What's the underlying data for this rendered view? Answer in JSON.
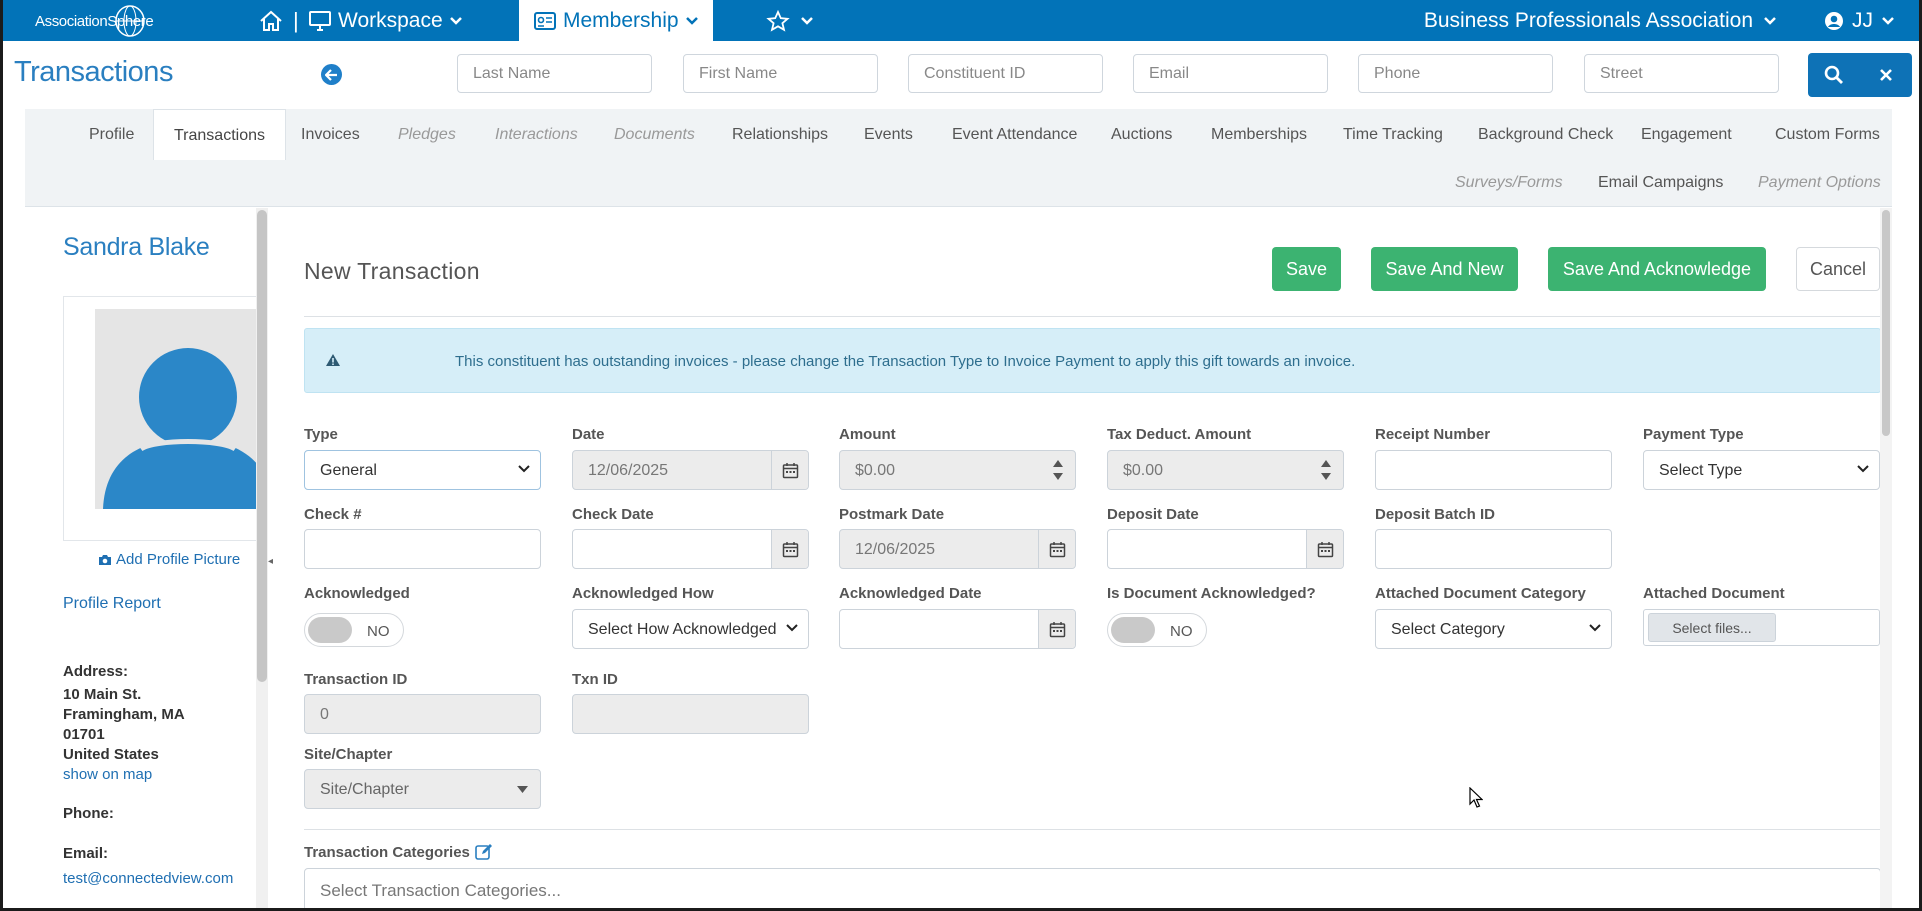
{
  "topbar": {
    "logo_text": "AssociationSphere",
    "separator": "|",
    "workspace_label": "Workspace",
    "membership_label": "Membership",
    "org_name": "Business Professionals Association",
    "user_initials": "JJ"
  },
  "search": {
    "page_title": "Transactions",
    "fields": {
      "last_name": "Last Name",
      "first_name": "First Name",
      "constituent_id": "Constituent ID",
      "email": "Email",
      "phone": "Phone",
      "street": "Street"
    }
  },
  "tabs": {
    "profile": "Profile",
    "transactions": "Transactions",
    "invoices": "Invoices",
    "pledges": "Pledges",
    "interactions": "Interactions",
    "documents": "Documents",
    "relationships": "Relationships",
    "events": "Events",
    "event_attendance": "Event Attendance",
    "auctions": "Auctions",
    "memberships": "Memberships",
    "time_tracking": "Time Tracking",
    "background_check": "Background Check",
    "engagement": "Engagement",
    "custom_forms": "Custom Forms",
    "surveys_forms": "Surveys/Forms",
    "email_campaigns": "Email Campaigns",
    "payment_options": "Payment Options"
  },
  "profile": {
    "name": "Sandra Blake",
    "add_picture": "Add Profile Picture",
    "profile_report": "Profile Report",
    "address_label": "Address:",
    "address_line1": "10 Main St.",
    "address_line2": "Framingham, MA",
    "address_line3": "01701",
    "address_line4": "United States",
    "show_on_map": "show on map",
    "phone_label": "Phone:",
    "email_label": "Email:",
    "email": "test@connectedview.com"
  },
  "form": {
    "title": "New Transaction",
    "buttons": {
      "save": "Save",
      "save_and_new": "Save And New",
      "save_and_acknowledge": "Save And Acknowledge",
      "cancel": "Cancel"
    },
    "alert": "This constituent has outstanding invoices - please change the Transaction Type to Invoice Payment to apply this gift towards an invoice.",
    "labels": {
      "type": "Type",
      "date": "Date",
      "amount": "Amount",
      "tax_deduct_amount": "Tax Deduct. Amount",
      "receipt_number": "Receipt Number",
      "payment_type": "Payment Type",
      "check_no": "Check #",
      "check_date": "Check Date",
      "postmark_date": "Postmark Date",
      "deposit_date": "Deposit Date",
      "deposit_batch_id": "Deposit Batch ID",
      "acknowledged": "Acknowledged",
      "acknowledged_how": "Acknowledged How",
      "acknowledged_date": "Acknowledged Date",
      "is_document_acknowledged": "Is Document Acknowledged?",
      "attached_document_category": "Attached Document Category",
      "attached_document": "Attached Document",
      "transaction_id": "Transaction ID",
      "txn_id": "Txn ID",
      "site_chapter": "Site/Chapter",
      "transaction_categories": "Transaction Categories"
    },
    "values": {
      "type": "General",
      "date": "12/06/2025",
      "amount": "$0.00",
      "tax_deduct_amount": "$0.00",
      "receipt_number": "",
      "payment_type": "Select Type",
      "check_no": "",
      "check_date": "",
      "postmark_date": "12/06/2025",
      "deposit_date": "",
      "deposit_batch_id": "",
      "acknowledged": "NO",
      "acknowledged_how": "Select How Acknowledged",
      "acknowledged_date": "",
      "is_document_acknowledged": "NO",
      "attached_document_category": "Select Category",
      "attached_document_button": "Select files...",
      "transaction_id": "0",
      "txn_id": "",
      "site_chapter": "Site/Chapter",
      "transaction_categories_placeholder": "Select Transaction Categories..."
    }
  },
  "colors": {
    "brand_blue": "#0273b8",
    "save_green": "#3cb371",
    "alert_bg": "#d6eef8"
  }
}
